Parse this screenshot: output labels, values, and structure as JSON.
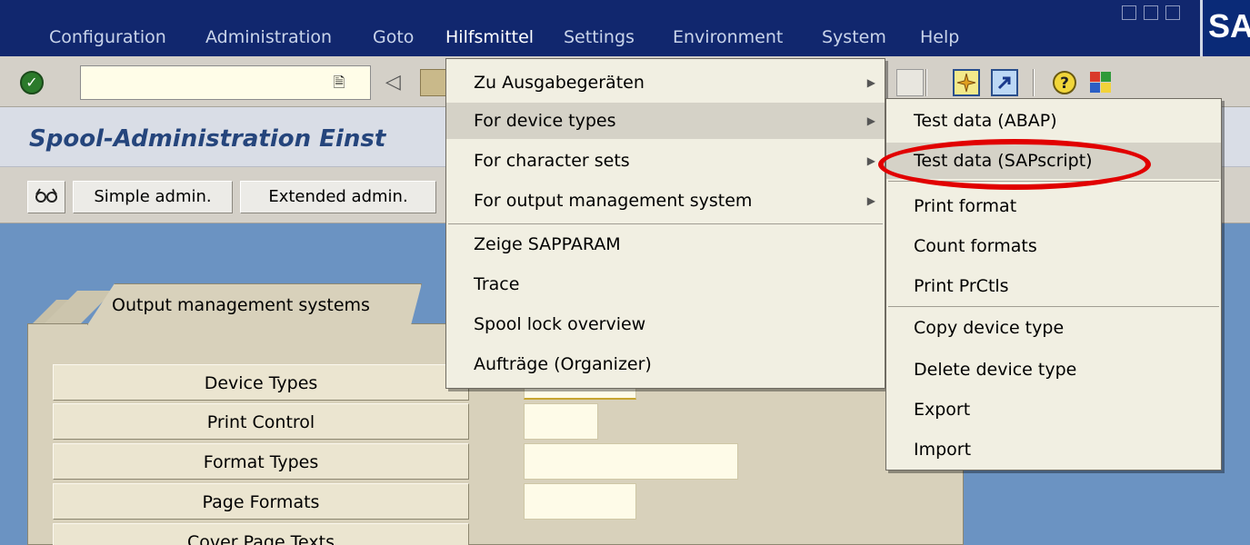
{
  "menubar": {
    "items": [
      "Configuration",
      "Administration",
      "Goto",
      "Hilfsmittel",
      "Settings",
      "Environment",
      "System",
      "Help"
    ],
    "active": "Hilfsmittel",
    "logo": "SA"
  },
  "toolbar": {
    "command_value": "",
    "icons": [
      "check-icon",
      "command-dropdown-icon",
      "back-icon",
      "save-icon",
      "layout-icon",
      "create-session-icon",
      "shortcut-icon",
      "help-icon",
      "customize-layout-icon"
    ]
  },
  "title": {
    "text": "Spool-Administration Einst"
  },
  "app_toolbar": {
    "buttons": [
      "Simple admin.",
      "Extended admin."
    ]
  },
  "tabs": {
    "active_tab": "Output management systems"
  },
  "function_buttons": [
    "Device Types",
    "Print Control",
    "Format Types",
    "Page Formats",
    "Cover Page Texts"
  ],
  "hilfsmittel_menu": {
    "items": [
      "Zu Ausgabegeräten",
      "For device types",
      "For character sets",
      "For output management system",
      "Zeige SAPPARAM",
      "Trace",
      "Spool lock overview",
      "Aufträge (Organizer)"
    ]
  },
  "device_types_submenu": {
    "items": [
      "Test data (ABAP)",
      "Test data (SAPscript)",
      "Print format",
      "Count formats",
      "Print PrCtls",
      "Copy device type",
      "Delete device type",
      "Export",
      "Import"
    ],
    "highlighted": "Test data (SAPscript)"
  },
  "colors": {
    "menubar_bg": "#11276e",
    "title_color": "#25457c",
    "highlight_circle": "#e10000",
    "content_bg": "#6b93c2"
  }
}
